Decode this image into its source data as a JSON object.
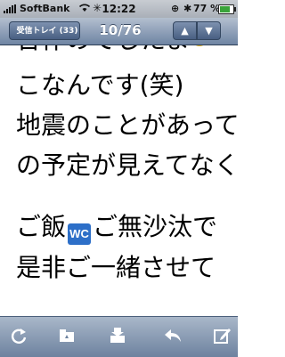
{
  "status_bar": {
    "carrier": "SoftBank",
    "time": "12:22",
    "battery_percent": "77 %",
    "battery_level": 0.77
  },
  "nav": {
    "back_label": "受信トレイ (33)",
    "counter": "10/76"
  },
  "message": {
    "lines": [
      "合作のでしたま",
      "こなんです(笑)",
      "地震のことがあって",
      "の予定が見えてなく",
      "ご飯",
      "ご無沙汰で",
      "是非ご一緒させて"
    ],
    "emoji": "WC"
  },
  "toolbar": {
    "icons": [
      "refresh-icon",
      "folder-icon",
      "move-icon",
      "reply-icon",
      "compose-icon"
    ]
  },
  "colors": {
    "nav_bar": "#6e84a3",
    "toolbar": "#6d829f",
    "wc_emoji": "#2d6fc8",
    "battery": "#3aa33a"
  }
}
